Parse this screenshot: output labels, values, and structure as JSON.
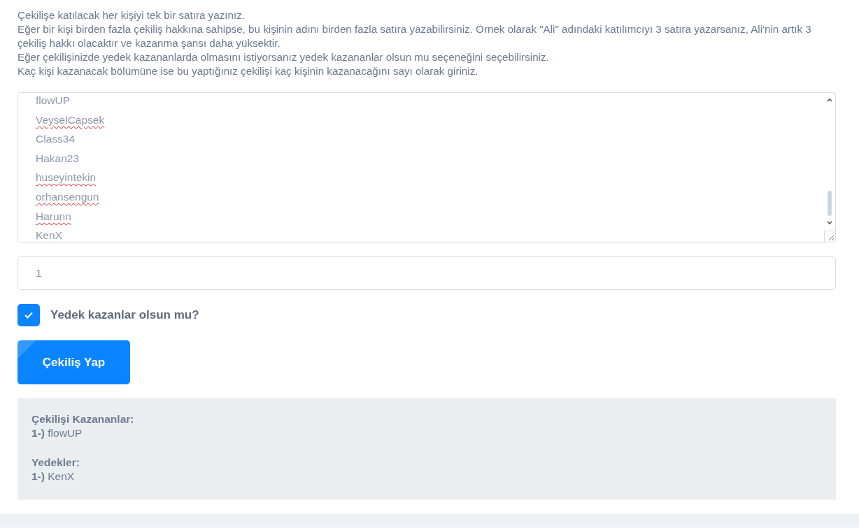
{
  "instructions": [
    "Çekilişe katılacak her kişiyi tek bir satıra yazınız.",
    "Eğer bir kişi birden fazla çekiliş hakkına sahipse, bu kişinin adını birden fazla satıra yazabilirsiniz. Örnek olarak \"Ali\" adındaki katılımcıyı 3 satıra yazarsanız, Ali'nin artık 3 çekiliş hakkı olacaktır ve kazanma şansı daha yüksektir.",
    "Eğer çekilişinizde yedek kazananlarda olmasını istiyorsanız yedek kazananlar olsun mu seçeneğini seçebilirsiniz.",
    "Kaç kişi kazanacak bölümüne ise bu yaptığınız çekilişi kaç kişinin kazanacağını sayı olarak giriniz."
  ],
  "participants": [
    {
      "name": "flowUP",
      "misspelled": false
    },
    {
      "name": "VeyselCapsek",
      "misspelled": true
    },
    {
      "name": "Class34",
      "misspelled": false
    },
    {
      "name": "Hakan23",
      "misspelled": false
    },
    {
      "name": "huseyintekin",
      "misspelled": true
    },
    {
      "name": "orhansengun",
      "misspelled": true
    },
    {
      "name": "Harunn",
      "misspelled": true
    },
    {
      "name": "KenX",
      "misspelled": true
    }
  ],
  "winner_count": {
    "value": "1"
  },
  "backup_option": {
    "label": "Yedek kazanlar olsun mu?",
    "checked": true
  },
  "draw_button": "Çekiliş Yap",
  "results": {
    "winners_title": "Çekilişi Kazananlar:",
    "winners": [
      "**1-)** flowUP"
    ],
    "backups_title": "Yedekler:",
    "backups": [
      "**1-)** KenX"
    ]
  }
}
